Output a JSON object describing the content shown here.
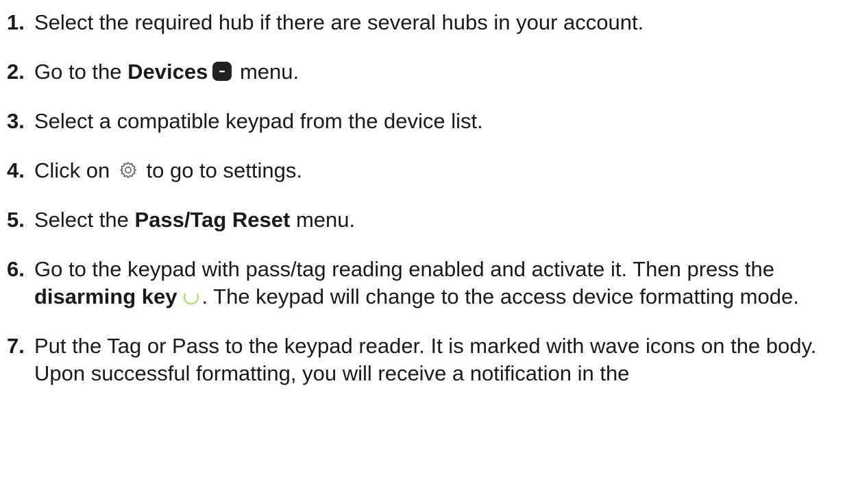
{
  "steps": [
    {
      "number": "1.",
      "text": "Select the required hub if there are several hubs in your account."
    },
    {
      "number": "2.",
      "pre": "Go to the ",
      "bold": "Devices",
      "post": " menu.",
      "icon": "devices-menu-icon"
    },
    {
      "number": "3.",
      "text": "Select a compatible keypad from the device list."
    },
    {
      "number": "4.",
      "pre": "Click on ",
      "post": " to go to settings.",
      "icon": "gear-icon"
    },
    {
      "number": "5.",
      "pre": "Select the ",
      "bold": "Pass/Tag Reset",
      "post": " menu."
    },
    {
      "number": "6.",
      "pre": "Go to the keypad with pass/tag reading enabled and activate it. Then press the ",
      "bold": "disarming key",
      "post": ". The keypad will change to the access device formatting mode.",
      "icon": "disarm-key-icon"
    },
    {
      "number": "7.",
      "text": "Put the Tag or Pass to the keypad reader. It is marked with wave icons on the body. Upon successful formatting, you will receive a notification in the"
    }
  ],
  "colors": {
    "text": "#1a1a1a",
    "icon_dark": "#1f2024",
    "disarm_green": "#8fe03a",
    "gear_stroke": "#555555"
  }
}
